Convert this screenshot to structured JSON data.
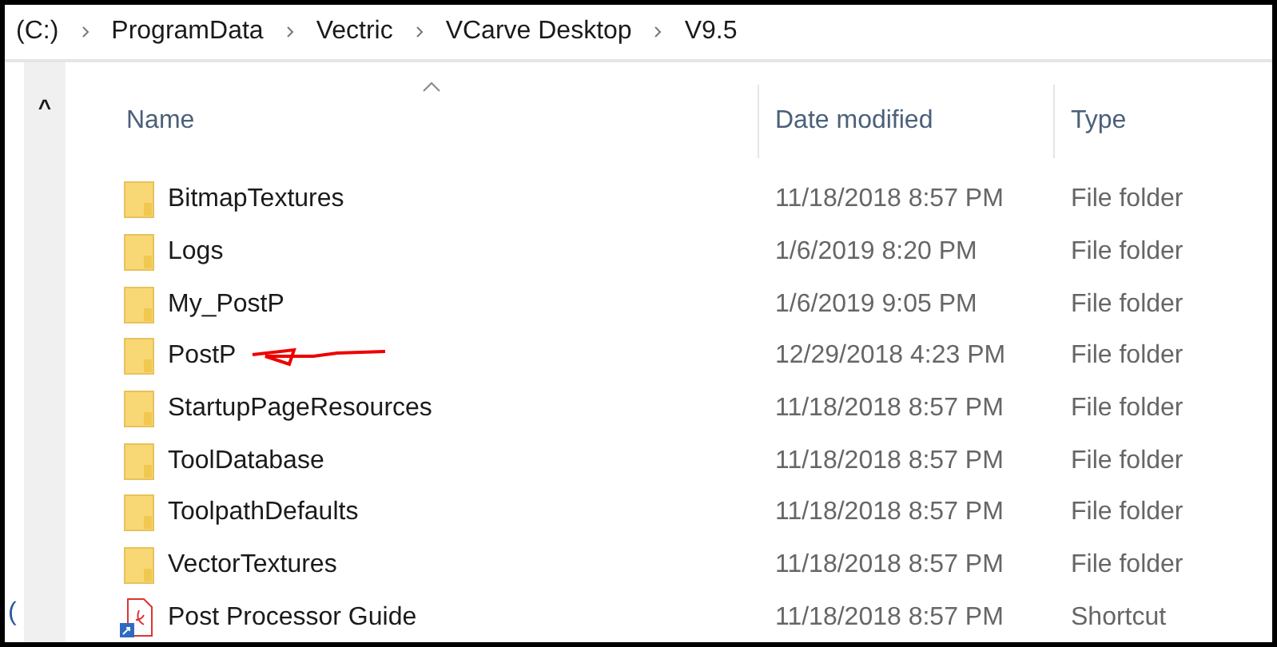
{
  "breadcrumb": [
    "(C:)",
    "ProgramData",
    "Vectric",
    "VCarve Desktop",
    "V9.5"
  ],
  "nav_pane": {
    "scroll_up": "^",
    "cut_text": "("
  },
  "columns": [
    {
      "label": "Name",
      "sorted": true
    },
    {
      "label": "Date modified",
      "sorted": false
    },
    {
      "label": "Type",
      "sorted": false
    }
  ],
  "rows": [
    {
      "kind": "folder",
      "name": "BitmapTextures",
      "date": "11/18/2018 8:57 PM",
      "type": "File folder",
      "annotated": false
    },
    {
      "kind": "folder",
      "name": "Logs",
      "date": "1/6/2019 8:20 PM",
      "type": "File folder",
      "annotated": false
    },
    {
      "kind": "folder",
      "name": "My_PostP",
      "date": "1/6/2019 9:05 PM",
      "type": "File folder",
      "annotated": false
    },
    {
      "kind": "folder",
      "name": "PostP",
      "date": "12/29/2018 4:23 PM",
      "type": "File folder",
      "annotated": true
    },
    {
      "kind": "folder",
      "name": "StartupPageResources",
      "date": "11/18/2018 8:57 PM",
      "type": "File folder",
      "annotated": false
    },
    {
      "kind": "folder",
      "name": "ToolDatabase",
      "date": "11/18/2018 8:57 PM",
      "type": "File folder",
      "annotated": false
    },
    {
      "kind": "folder",
      "name": "ToolpathDefaults",
      "date": "11/18/2018 8:57 PM",
      "type": "File folder",
      "annotated": false
    },
    {
      "kind": "folder",
      "name": "VectorTextures",
      "date": "11/18/2018 8:57 PM",
      "type": "File folder",
      "annotated": false
    },
    {
      "kind": "shortcut",
      "name": "Post Processor Guide",
      "date": "11/18/2018 8:57 PM",
      "type": "Shortcut",
      "annotated": false
    }
  ]
}
